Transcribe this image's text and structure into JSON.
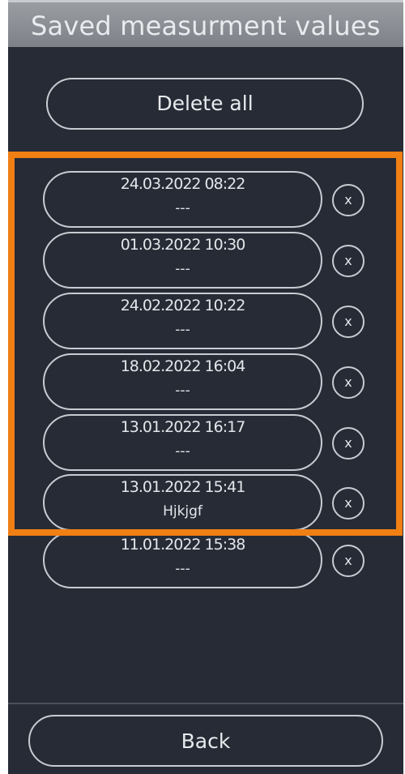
{
  "header": {
    "title": "Saved measurment values"
  },
  "actions": {
    "delete_all_label": "Delete all",
    "back_label": "Back"
  },
  "entries": [
    {
      "date": "24.03.2022 08:22",
      "note": "---",
      "delete_icon": "x"
    },
    {
      "date": "01.03.2022 10:30",
      "note": "---",
      "delete_icon": "x"
    },
    {
      "date": "24.02.2022 10:22",
      "note": "---",
      "delete_icon": "x"
    },
    {
      "date": "18.02.2022 16:04",
      "note": "---",
      "delete_icon": "x"
    },
    {
      "date": "13.01.2022 16:17",
      "note": "---",
      "delete_icon": "x"
    },
    {
      "date": "13.01.2022 15:41",
      "note": "Hjkjgf",
      "delete_icon": "x"
    },
    {
      "date": "11.01.2022 15:38",
      "note": "---",
      "delete_icon": "x"
    }
  ],
  "colors": {
    "background": "#262b36",
    "title_bar": "#8a8d92",
    "outline": "#c8ccd2",
    "highlight": "#f07f14"
  }
}
